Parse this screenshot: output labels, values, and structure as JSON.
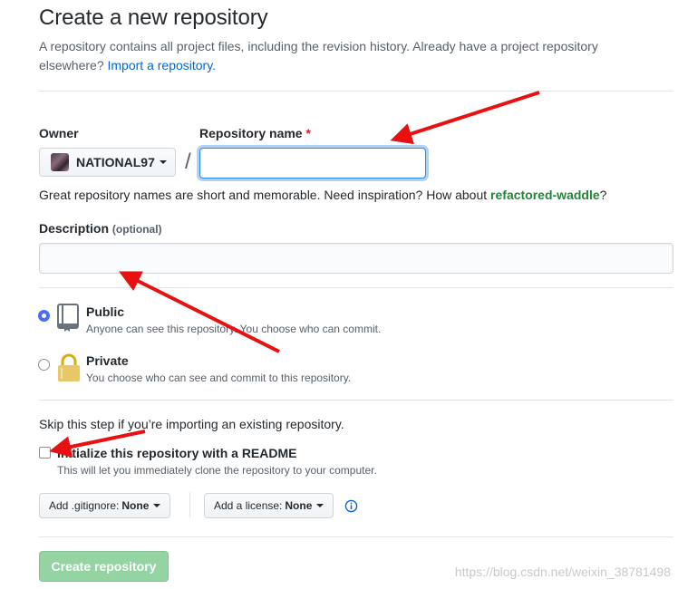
{
  "page": {
    "title": "Create a new repository",
    "subtitle_text": "A repository contains all project files, including the revision history. Already have a project repository elsewhere?",
    "import_link": "Import a repository."
  },
  "owner": {
    "label": "Owner",
    "value": "NATIONAL97"
  },
  "repo_name": {
    "label": "Repository name",
    "required_mark": "*",
    "value": "",
    "placeholder": ""
  },
  "slash": "/",
  "name_hint": {
    "prefix": "Great repository names are short and memorable. Need inspiration? How about",
    "suggestion": "refactored-waddle",
    "suffix": "?"
  },
  "description": {
    "label": "Description",
    "optional": "(optional)",
    "value": ""
  },
  "visibility": {
    "public": {
      "title": "Public",
      "desc": "Anyone can see this repository. You choose who can commit.",
      "selected": true
    },
    "private": {
      "title": "Private",
      "desc": "You choose who can see and commit to this repository.",
      "selected": false
    }
  },
  "init": {
    "skip_text": "Skip this step if you’re importing an existing repository.",
    "readme_label": "Initialize this repository with a README",
    "readme_desc": "This will let you immediately clone the repository to your computer.",
    "readme_checked": false
  },
  "gitignore": {
    "label": "Add .gitignore:",
    "value": "None"
  },
  "license": {
    "label": "Add a license:",
    "value": "None"
  },
  "create_button": "Create repository",
  "watermark": "https://blog.csdn.net/weixin_38781498",
  "colors": {
    "accent_blue": "#0366d6",
    "suggest_green": "#22863a",
    "create_btn": "#94d3a2",
    "annotation_red": "#e81010"
  }
}
